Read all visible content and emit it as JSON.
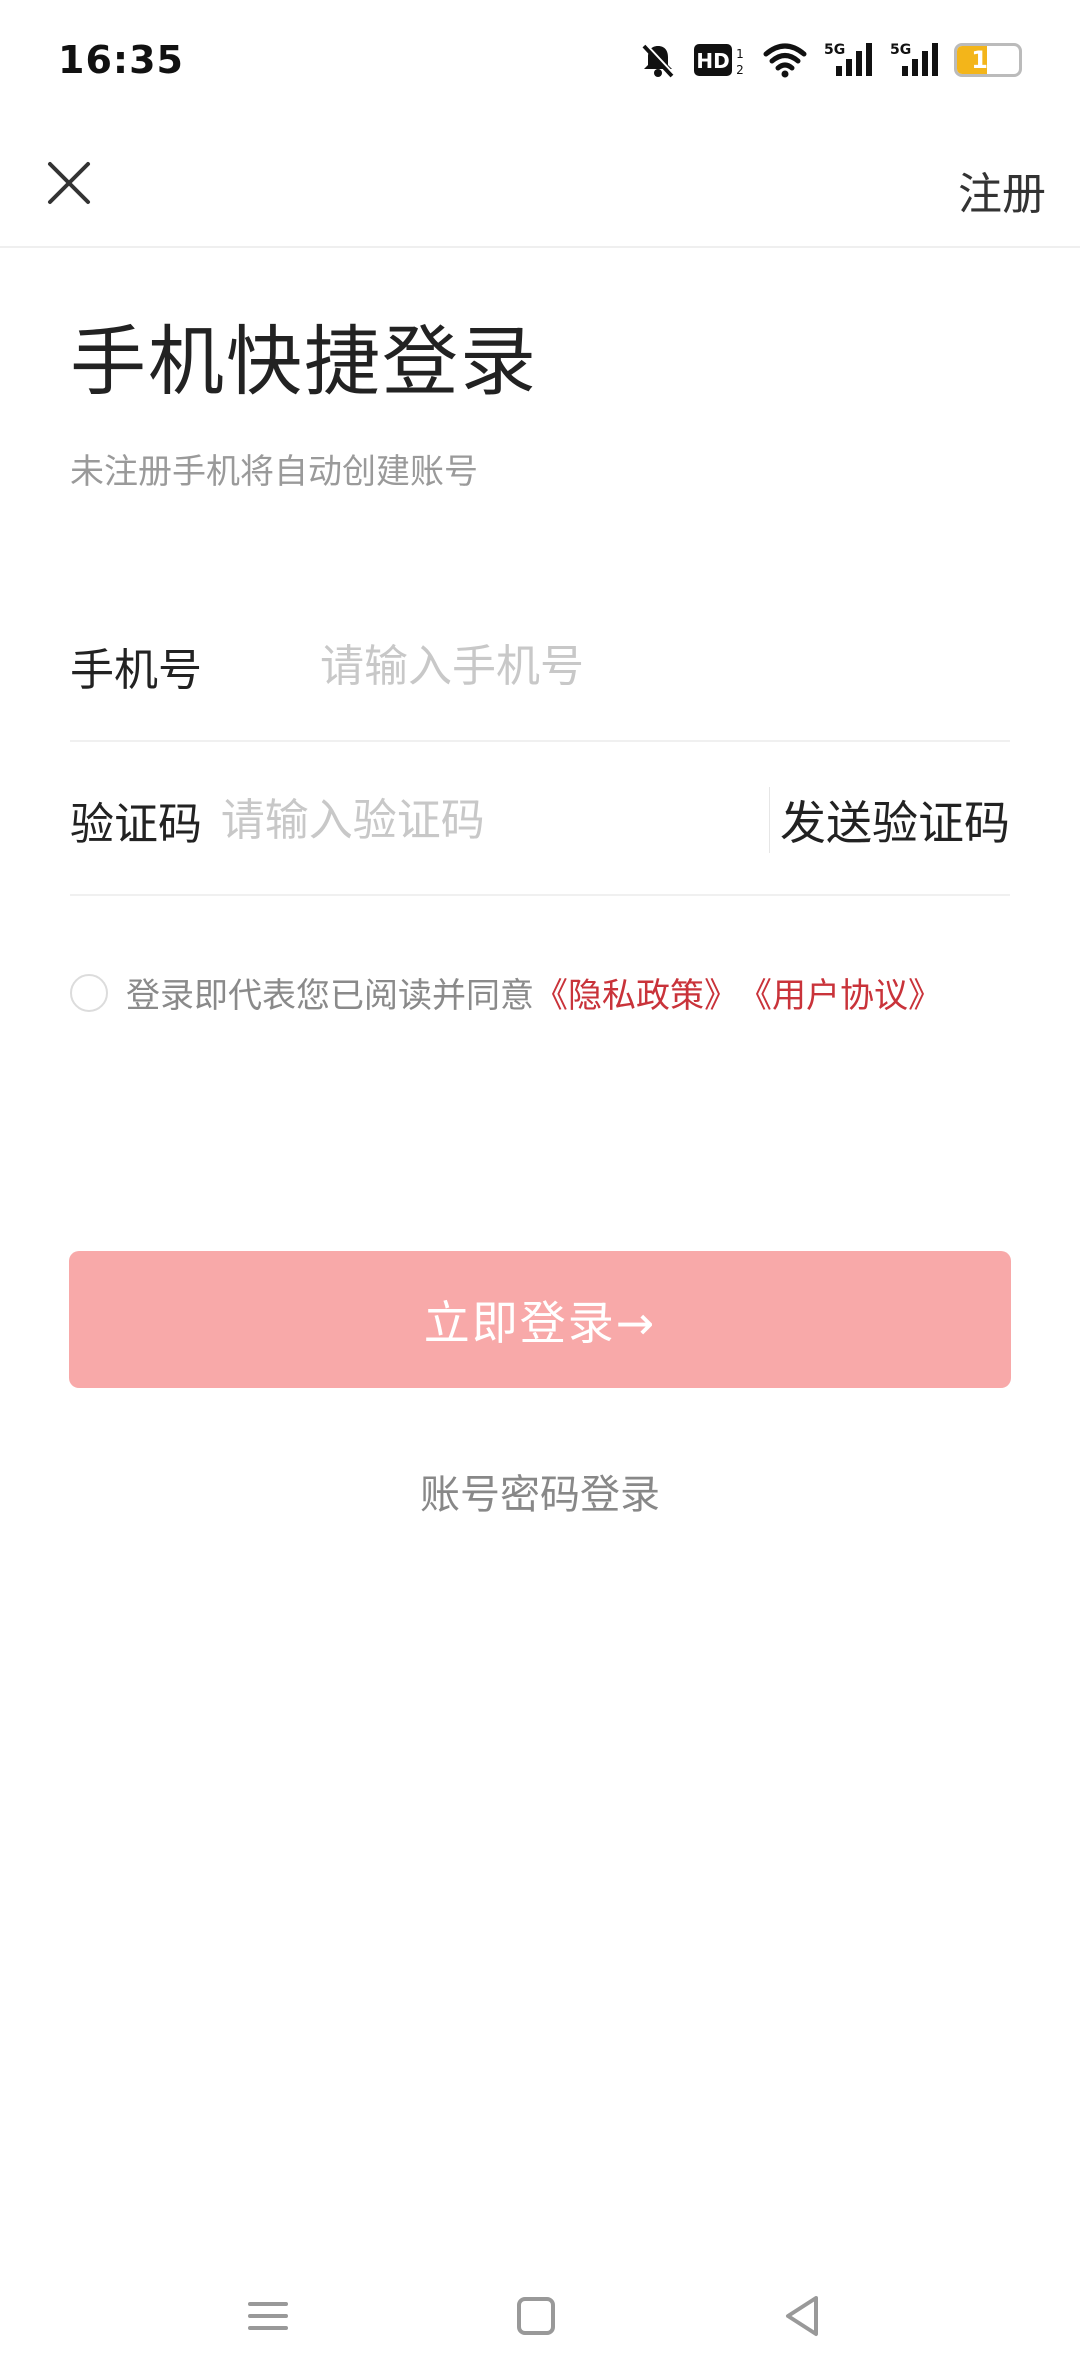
{
  "status_bar": {
    "time": "16:35",
    "battery_level": "17",
    "network_labels": [
      "HD",
      "5G",
      "5G"
    ],
    "icons": [
      "mute-bell-icon",
      "hd-icon",
      "wifi-icon",
      "signal-5g-icon",
      "signal-5g-icon",
      "battery-icon"
    ],
    "battery_color": "#f3b51a"
  },
  "nav": {
    "close_icon": "close-icon",
    "register_label": "注册"
  },
  "header": {
    "title": "手机快捷登录",
    "subtitle": "未注册手机将自动创建账号"
  },
  "form": {
    "phone": {
      "label": "手机号",
      "placeholder": "请输入手机号",
      "value": ""
    },
    "code": {
      "label": "验证码",
      "placeholder": "请输入验证码",
      "value": "",
      "send_label": "发送验证码"
    }
  },
  "agreement": {
    "checked": false,
    "text": "登录即代表您已阅读并同意",
    "privacy_link": "《隐私政策》",
    "user_link": "《用户协议》",
    "link_color": "#c9333a"
  },
  "actions": {
    "login_label": "立即登录→",
    "login_color": "#f8a9a9",
    "alt_login_label": "账号密码登录"
  },
  "system_nav": {
    "icons": [
      "menu-icon",
      "home-icon",
      "back-icon"
    ]
  }
}
